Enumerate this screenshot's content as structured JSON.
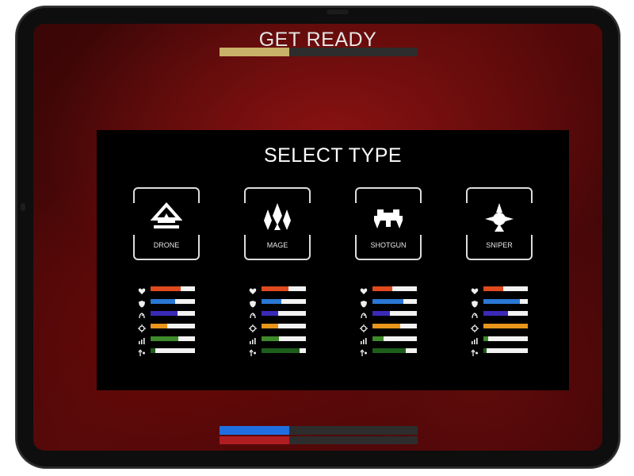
{
  "header": {
    "title": "GET READY",
    "progress": 0.35,
    "progress_color": "#c8b168"
  },
  "panel": {
    "title": "SELECT TYPE"
  },
  "stat_names": [
    "health-icon",
    "shield-icon",
    "speed-icon",
    "damage-icon",
    "range-icon",
    "regen-icon"
  ],
  "stat_colors": [
    "#e04a1e",
    "#2a78d4",
    "#3b2ab8",
    "#e8951c",
    "#3f8a2c",
    "#1d5e1a"
  ],
  "types": [
    {
      "label": "DRONE",
      "icon": "drone-icon",
      "stats": [
        0.68,
        0.55,
        0.6,
        0.38,
        0.62,
        0.1
      ]
    },
    {
      "label": "MAGE",
      "icon": "mage-icon",
      "stats": [
        0.6,
        0.45,
        0.38,
        0.38,
        0.4,
        0.85
      ]
    },
    {
      "label": "SHOTGUN",
      "icon": "shotgun-icon",
      "stats": [
        0.45,
        0.7,
        0.4,
        0.62,
        0.25,
        0.75
      ]
    },
    {
      "label": "SNIPER",
      "icon": "sniper-icon",
      "stats": [
        0.45,
        0.82,
        0.55,
        1.0,
        0.1,
        0.08
      ]
    }
  ],
  "footer": {
    "team_blue": 0.35,
    "team_blue_color": "#1f6fe0",
    "team_red": 0.35,
    "team_red_color": "#b01e22"
  }
}
